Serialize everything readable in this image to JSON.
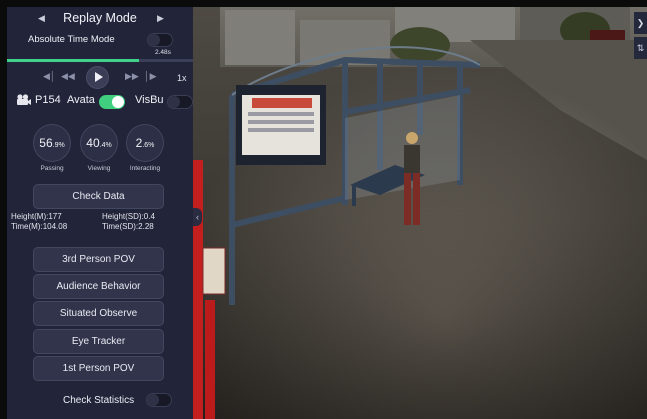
{
  "panel": {
    "mode_title": "Replay Mode",
    "absolute_time_label": "Absolute Time Mode",
    "absolute_time_on": false,
    "time_value": "2.48s",
    "progress_fraction": 0.71,
    "speed_label": "1x",
    "participant_label": "P154",
    "avatar_label": "Avata",
    "avatar_on": true,
    "visbu_label": "VisBu",
    "visbu_on": false,
    "stats": [
      {
        "value": "56",
        "unit": ".9%",
        "label": "Passing"
      },
      {
        "value": "40",
        "unit": ".4%",
        "label": "Viewing"
      },
      {
        "value": "2",
        "unit": ".6%",
        "label": "Interacting"
      }
    ],
    "check_data_label": "Check Data",
    "metrics": {
      "height_mean": "Height(M):177",
      "height_sd": "Height(SD):0.4",
      "time_mean": "Time(M):104.08",
      "time_sd": "Time(SD):2.28"
    },
    "buttons": [
      "3rd Person POV",
      "Audience Behavior",
      "Situated Observe",
      "Eye Tracker",
      "1st Person POV"
    ],
    "check_statistics_label": "Check Statistics",
    "check_statistics_on": false
  },
  "colors": {
    "panel_bg": "#22253a",
    "accent_green": "#40d28b",
    "button_bg": "#31344b"
  },
  "icons": {
    "prev": "chevron-left-icon",
    "next": "chevron-right-icon",
    "participant": "camera-icon",
    "collapse": "chevron-left-icon"
  }
}
